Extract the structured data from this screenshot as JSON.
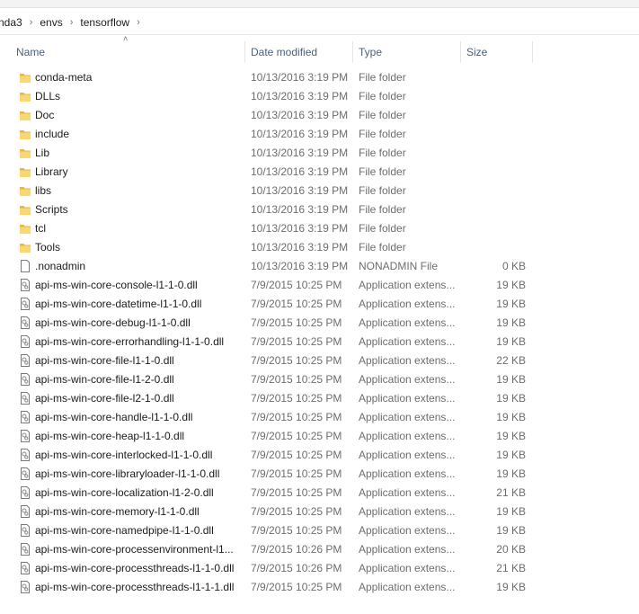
{
  "breadcrumb": {
    "parts": [
      "nda3",
      "envs",
      "tensorflow"
    ]
  },
  "columns": {
    "name": "Name",
    "date": "Date modified",
    "type": "Type",
    "size": "Size"
  },
  "colors": {
    "folder": "#f8d775",
    "folder_dark": "#e8b640",
    "file_outline": "#7a7a7a",
    "header_text": "#4c607a"
  },
  "files": [
    {
      "name": "conda-meta",
      "date": "10/13/2016 3:19 PM",
      "type": "File folder",
      "size": "",
      "icon": "folder-icon"
    },
    {
      "name": "DLLs",
      "date": "10/13/2016 3:19 PM",
      "type": "File folder",
      "size": "",
      "icon": "folder-icon"
    },
    {
      "name": "Doc",
      "date": "10/13/2016 3:19 PM",
      "type": "File folder",
      "size": "",
      "icon": "folder-icon"
    },
    {
      "name": "include",
      "date": "10/13/2016 3:19 PM",
      "type": "File folder",
      "size": "",
      "icon": "folder-icon"
    },
    {
      "name": "Lib",
      "date": "10/13/2016 3:19 PM",
      "type": "File folder",
      "size": "",
      "icon": "folder-icon"
    },
    {
      "name": "Library",
      "date": "10/13/2016 3:19 PM",
      "type": "File folder",
      "size": "",
      "icon": "folder-icon"
    },
    {
      "name": "libs",
      "date": "10/13/2016 3:19 PM",
      "type": "File folder",
      "size": "",
      "icon": "folder-icon"
    },
    {
      "name": "Scripts",
      "date": "10/13/2016 3:19 PM",
      "type": "File folder",
      "size": "",
      "icon": "folder-icon"
    },
    {
      "name": "tcl",
      "date": "10/13/2016 3:19 PM",
      "type": "File folder",
      "size": "",
      "icon": "folder-icon"
    },
    {
      "name": "Tools",
      "date": "10/13/2016 3:19 PM",
      "type": "File folder",
      "size": "",
      "icon": "folder-icon"
    },
    {
      "name": ".nonadmin",
      "date": "10/13/2016 3:19 PM",
      "type": "NONADMIN File",
      "size": "0 KB",
      "icon": "blank-file-icon"
    },
    {
      "name": "api-ms-win-core-console-l1-1-0.dll",
      "date": "7/9/2015 10:25 PM",
      "type": "Application extens...",
      "size": "19 KB",
      "icon": "dll-file-icon"
    },
    {
      "name": "api-ms-win-core-datetime-l1-1-0.dll",
      "date": "7/9/2015 10:25 PM",
      "type": "Application extens...",
      "size": "19 KB",
      "icon": "dll-file-icon"
    },
    {
      "name": "api-ms-win-core-debug-l1-1-0.dll",
      "date": "7/9/2015 10:25 PM",
      "type": "Application extens...",
      "size": "19 KB",
      "icon": "dll-file-icon"
    },
    {
      "name": "api-ms-win-core-errorhandling-l1-1-0.dll",
      "date": "7/9/2015 10:25 PM",
      "type": "Application extens...",
      "size": "19 KB",
      "icon": "dll-file-icon"
    },
    {
      "name": "api-ms-win-core-file-l1-1-0.dll",
      "date": "7/9/2015 10:25 PM",
      "type": "Application extens...",
      "size": "22 KB",
      "icon": "dll-file-icon"
    },
    {
      "name": "api-ms-win-core-file-l1-2-0.dll",
      "date": "7/9/2015 10:25 PM",
      "type": "Application extens...",
      "size": "19 KB",
      "icon": "dll-file-icon"
    },
    {
      "name": "api-ms-win-core-file-l2-1-0.dll",
      "date": "7/9/2015 10:25 PM",
      "type": "Application extens...",
      "size": "19 KB",
      "icon": "dll-file-icon"
    },
    {
      "name": "api-ms-win-core-handle-l1-1-0.dll",
      "date": "7/9/2015 10:25 PM",
      "type": "Application extens...",
      "size": "19 KB",
      "icon": "dll-file-icon"
    },
    {
      "name": "api-ms-win-core-heap-l1-1-0.dll",
      "date": "7/9/2015 10:25 PM",
      "type": "Application extens...",
      "size": "19 KB",
      "icon": "dll-file-icon"
    },
    {
      "name": "api-ms-win-core-interlocked-l1-1-0.dll",
      "date": "7/9/2015 10:25 PM",
      "type": "Application extens...",
      "size": "19 KB",
      "icon": "dll-file-icon"
    },
    {
      "name": "api-ms-win-core-libraryloader-l1-1-0.dll",
      "date": "7/9/2015 10:25 PM",
      "type": "Application extens...",
      "size": "19 KB",
      "icon": "dll-file-icon"
    },
    {
      "name": "api-ms-win-core-localization-l1-2-0.dll",
      "date": "7/9/2015 10:25 PM",
      "type": "Application extens...",
      "size": "21 KB",
      "icon": "dll-file-icon"
    },
    {
      "name": "api-ms-win-core-memory-l1-1-0.dll",
      "date": "7/9/2015 10:25 PM",
      "type": "Application extens...",
      "size": "19 KB",
      "icon": "dll-file-icon"
    },
    {
      "name": "api-ms-win-core-namedpipe-l1-1-0.dll",
      "date": "7/9/2015 10:25 PM",
      "type": "Application extens...",
      "size": "19 KB",
      "icon": "dll-file-icon"
    },
    {
      "name": "api-ms-win-core-processenvironment-l1...",
      "date": "7/9/2015 10:26 PM",
      "type": "Application extens...",
      "size": "20 KB",
      "icon": "dll-file-icon"
    },
    {
      "name": "api-ms-win-core-processthreads-l1-1-0.dll",
      "date": "7/9/2015 10:26 PM",
      "type": "Application extens...",
      "size": "21 KB",
      "icon": "dll-file-icon"
    },
    {
      "name": "api-ms-win-core-processthreads-l1-1-1.dll",
      "date": "7/9/2015 10:25 PM",
      "type": "Application extens...",
      "size": "19 KB",
      "icon": "dll-file-icon"
    }
  ]
}
